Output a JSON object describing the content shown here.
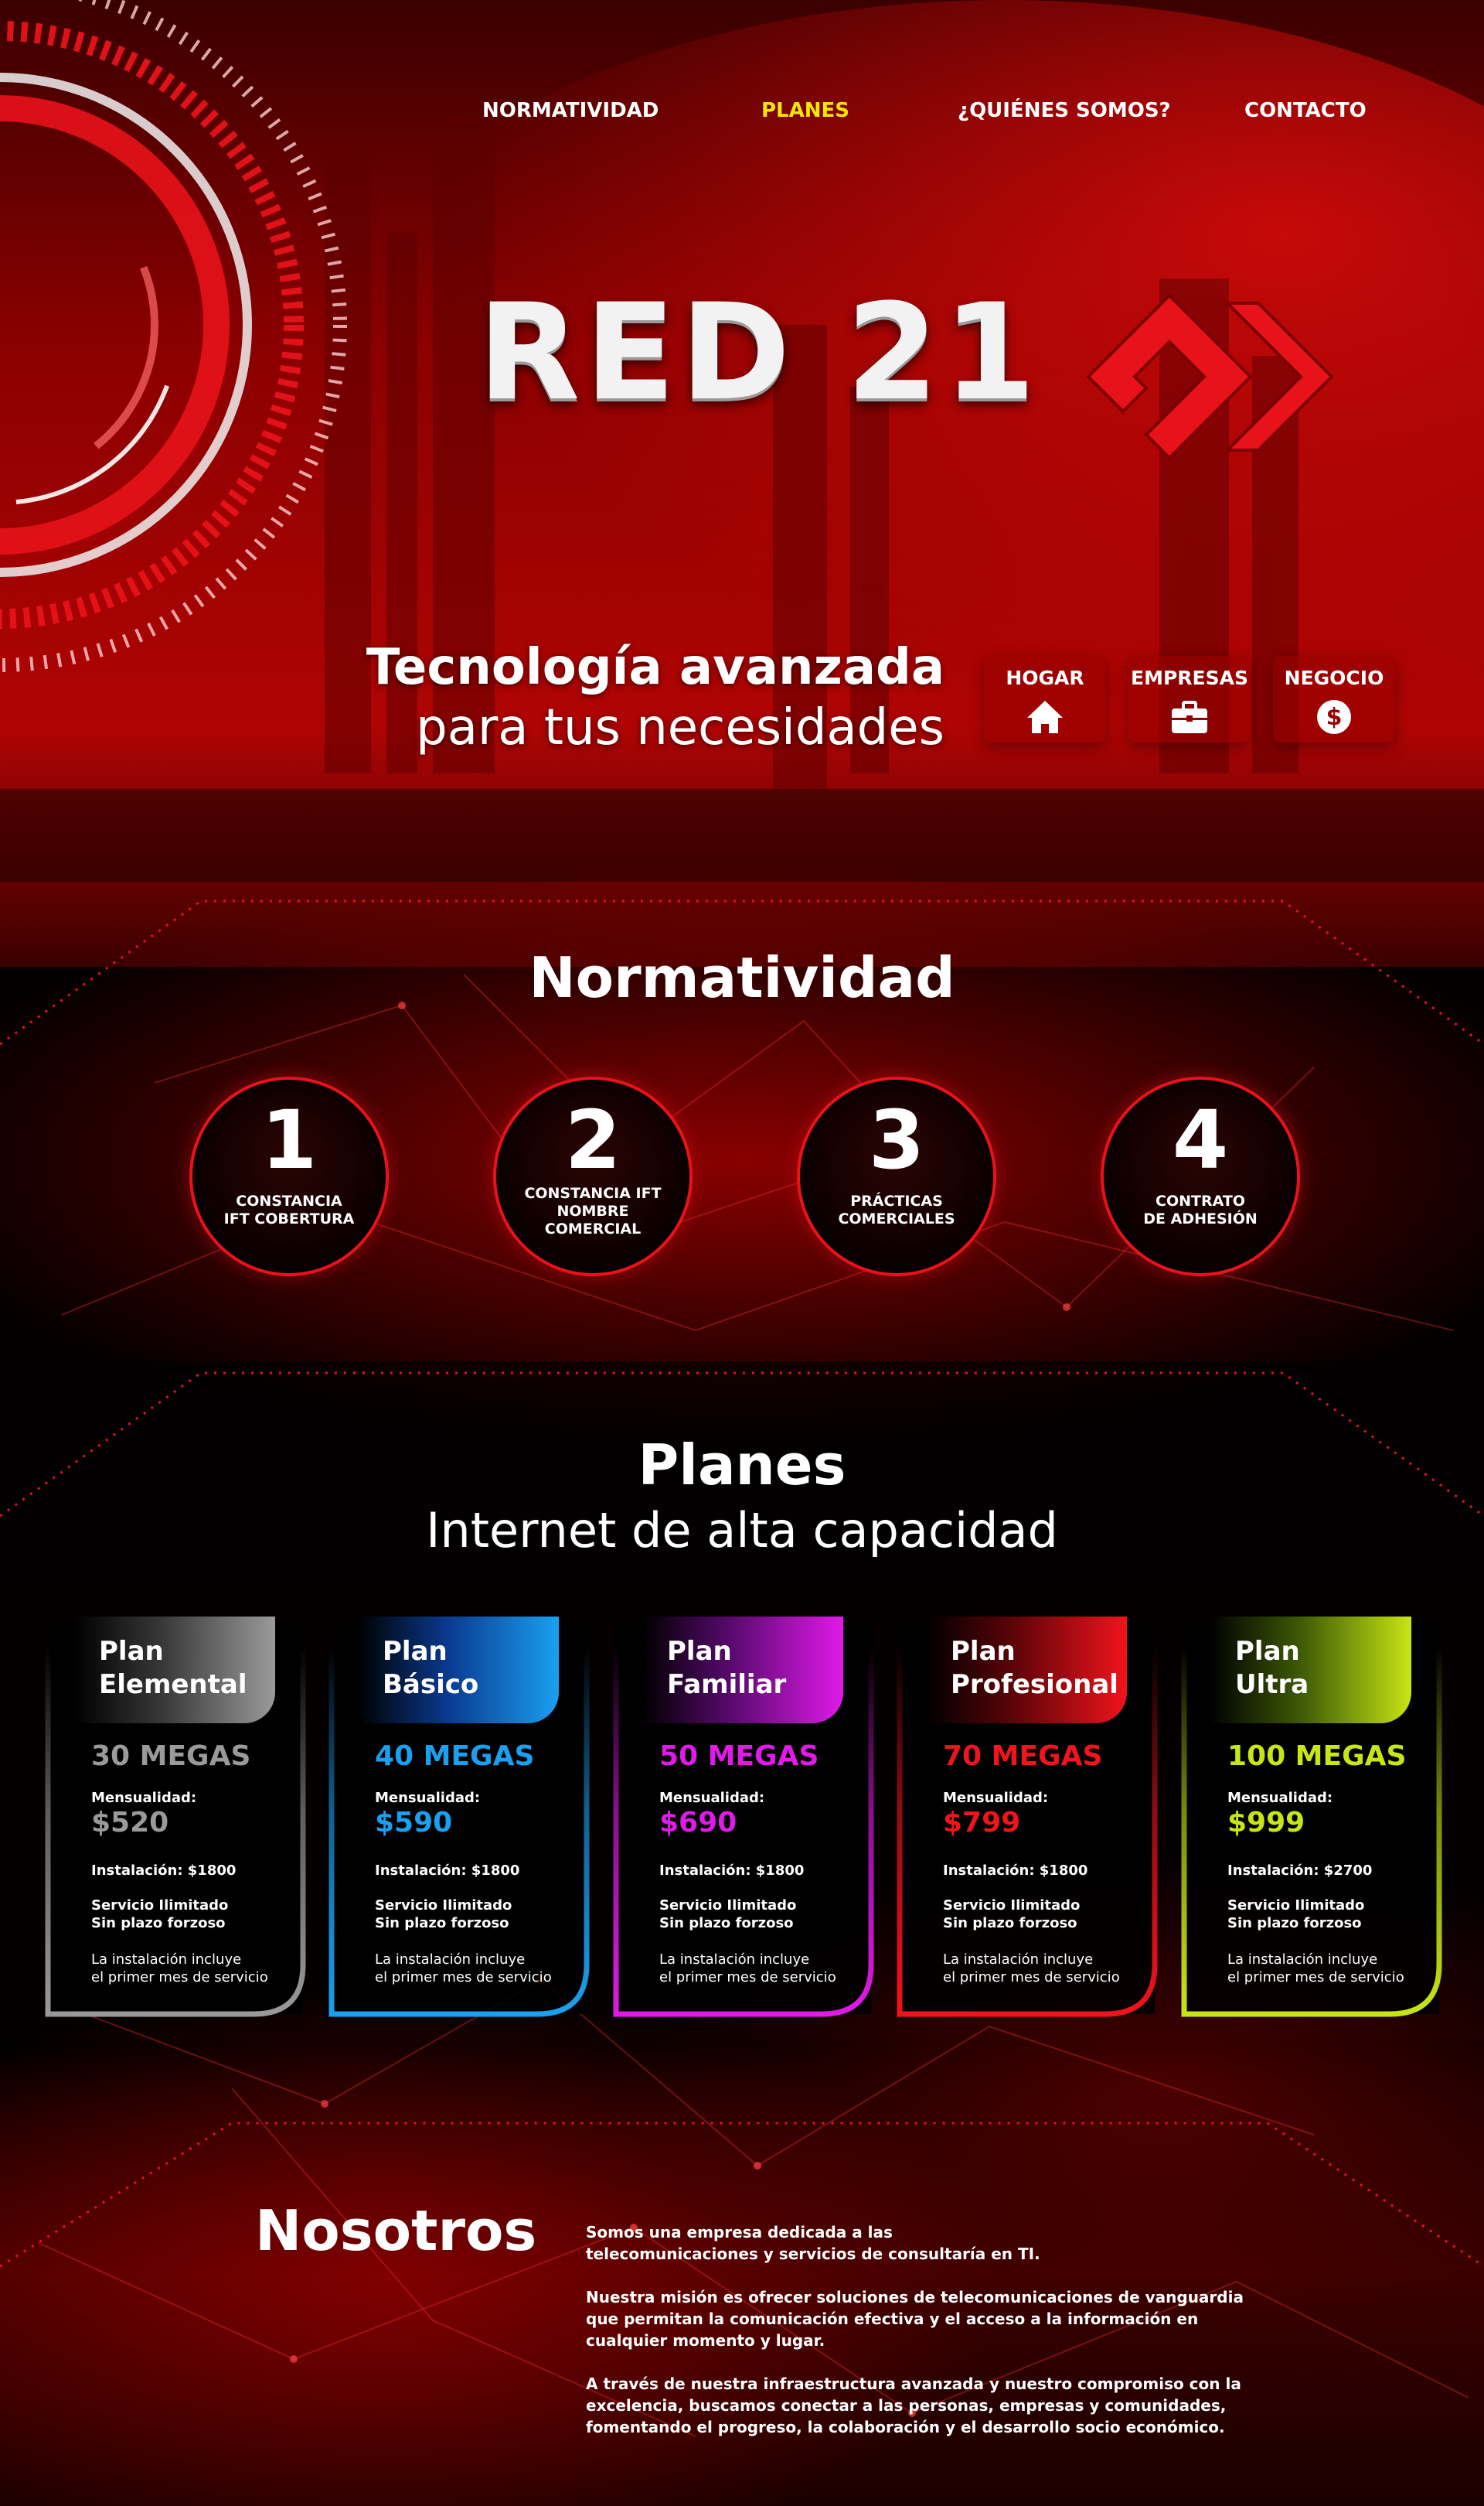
{
  "nav": {
    "items": [
      {
        "label": "NORMATIVIDAD",
        "active": false
      },
      {
        "label": "PLANES",
        "active": true
      },
      {
        "label": "¿QUIÉNES SOMOS?",
        "active": false
      },
      {
        "label": "CONTACTO",
        "active": false
      }
    ],
    "active_color": "#f5e60a"
  },
  "logo": {
    "text": "RED 21",
    "mark_color": "#e8121a"
  },
  "hero": {
    "title": "Tecnología avanzada",
    "subtitle": "para tus necesidades",
    "categories": [
      {
        "label": "HOGAR",
        "icon": "home-icon"
      },
      {
        "label": "EMPRESAS",
        "icon": "briefcase-icon"
      },
      {
        "label": "NEGOCIO",
        "icon": "dollar-icon"
      }
    ]
  },
  "normatividad": {
    "title": "Normatividad",
    "items": [
      {
        "number": "1",
        "label": "CONSTANCIA\nIFT COBERTURA"
      },
      {
        "number": "2",
        "label": "CONSTANCIA IFT\nNOMBRE\nCOMERCIAL"
      },
      {
        "number": "3",
        "label": "PRÁCTICAS\nCOMERCIALES"
      },
      {
        "number": "4",
        "label": "CONTRATO\nDE ADHESIÓN"
      }
    ]
  },
  "planes": {
    "title": "Planes",
    "subtitle": "Internet de alta capacidad",
    "cards": [
      {
        "name": "Plan\nElemental",
        "speed": "30 MEGAS",
        "monthly_label": "Mensualidad:",
        "price": "$520",
        "installation": "Instalación: $1800",
        "service": "Servicio Ilimitado\nSin plazo forzoso",
        "note": "La instalación incluye\nel primer mes de servicio",
        "color": "#9a9a9a",
        "color_dark": "#3a3a3a"
      },
      {
        "name": "Plan\nBásico",
        "speed": "40 MEGAS",
        "monthly_label": "Mensualidad:",
        "price": "$590",
        "installation": "Instalación: $1800",
        "service": "Servicio Ilimitado\nSin plazo forzoso",
        "note": "La instalación incluye\nel primer mes de servicio",
        "color": "#1aa0f0",
        "color_dark": "#0a3a90"
      },
      {
        "name": "Plan\nFamiliar",
        "speed": "50 MEGAS",
        "monthly_label": "Mensualidad:",
        "price": "$690",
        "installation": "Instalación: $1800",
        "service": "Servicio Ilimitado\nSin plazo forzoso",
        "note": "La instalación incluye\nel primer mes de servicio",
        "color": "#e01ae8",
        "color_dark": "#5a0a70"
      },
      {
        "name": "Plan\nProfesional",
        "speed": "70 MEGAS",
        "monthly_label": "Mensualidad:",
        "price": "$799",
        "installation": "Instalación: $1800",
        "service": "Servicio Ilimitado\nSin plazo forzoso",
        "note": "La instalación incluye\nel primer mes de servicio",
        "color": "#f0141c",
        "color_dark": "#600408"
      },
      {
        "name": "Plan\nUltra",
        "speed": "100 MEGAS",
        "monthly_label": "Mensualidad:",
        "price": "$999",
        "installation": "Instalación: $2700",
        "service": "Servicio Ilimitado\nSin plazo forzoso",
        "note": "La instalación incluye\nel primer mes de servicio",
        "color": "#c8e614",
        "color_dark": "#3e5a06"
      }
    ]
  },
  "nosotros": {
    "title": "Nosotros",
    "paragraphs": [
      "Somos una empresa dedicada a las\ntelecomunicaciones y servicios de consultaría en TI.",
      "Nuestra misión es ofrecer soluciones de telecomunicaciones de vanguardia\nque permitan la comunicación efectiva y el acceso a la información en\ncualquier momento y lugar.",
      "A través de nuestra infraestructura avanzada y nuestro compromiso con la\nexcelencia, buscamos conectar a las personas, empresas y comunidades,\nfomentando el progreso, la colaboración y el desarrollo socio económico."
    ]
  }
}
